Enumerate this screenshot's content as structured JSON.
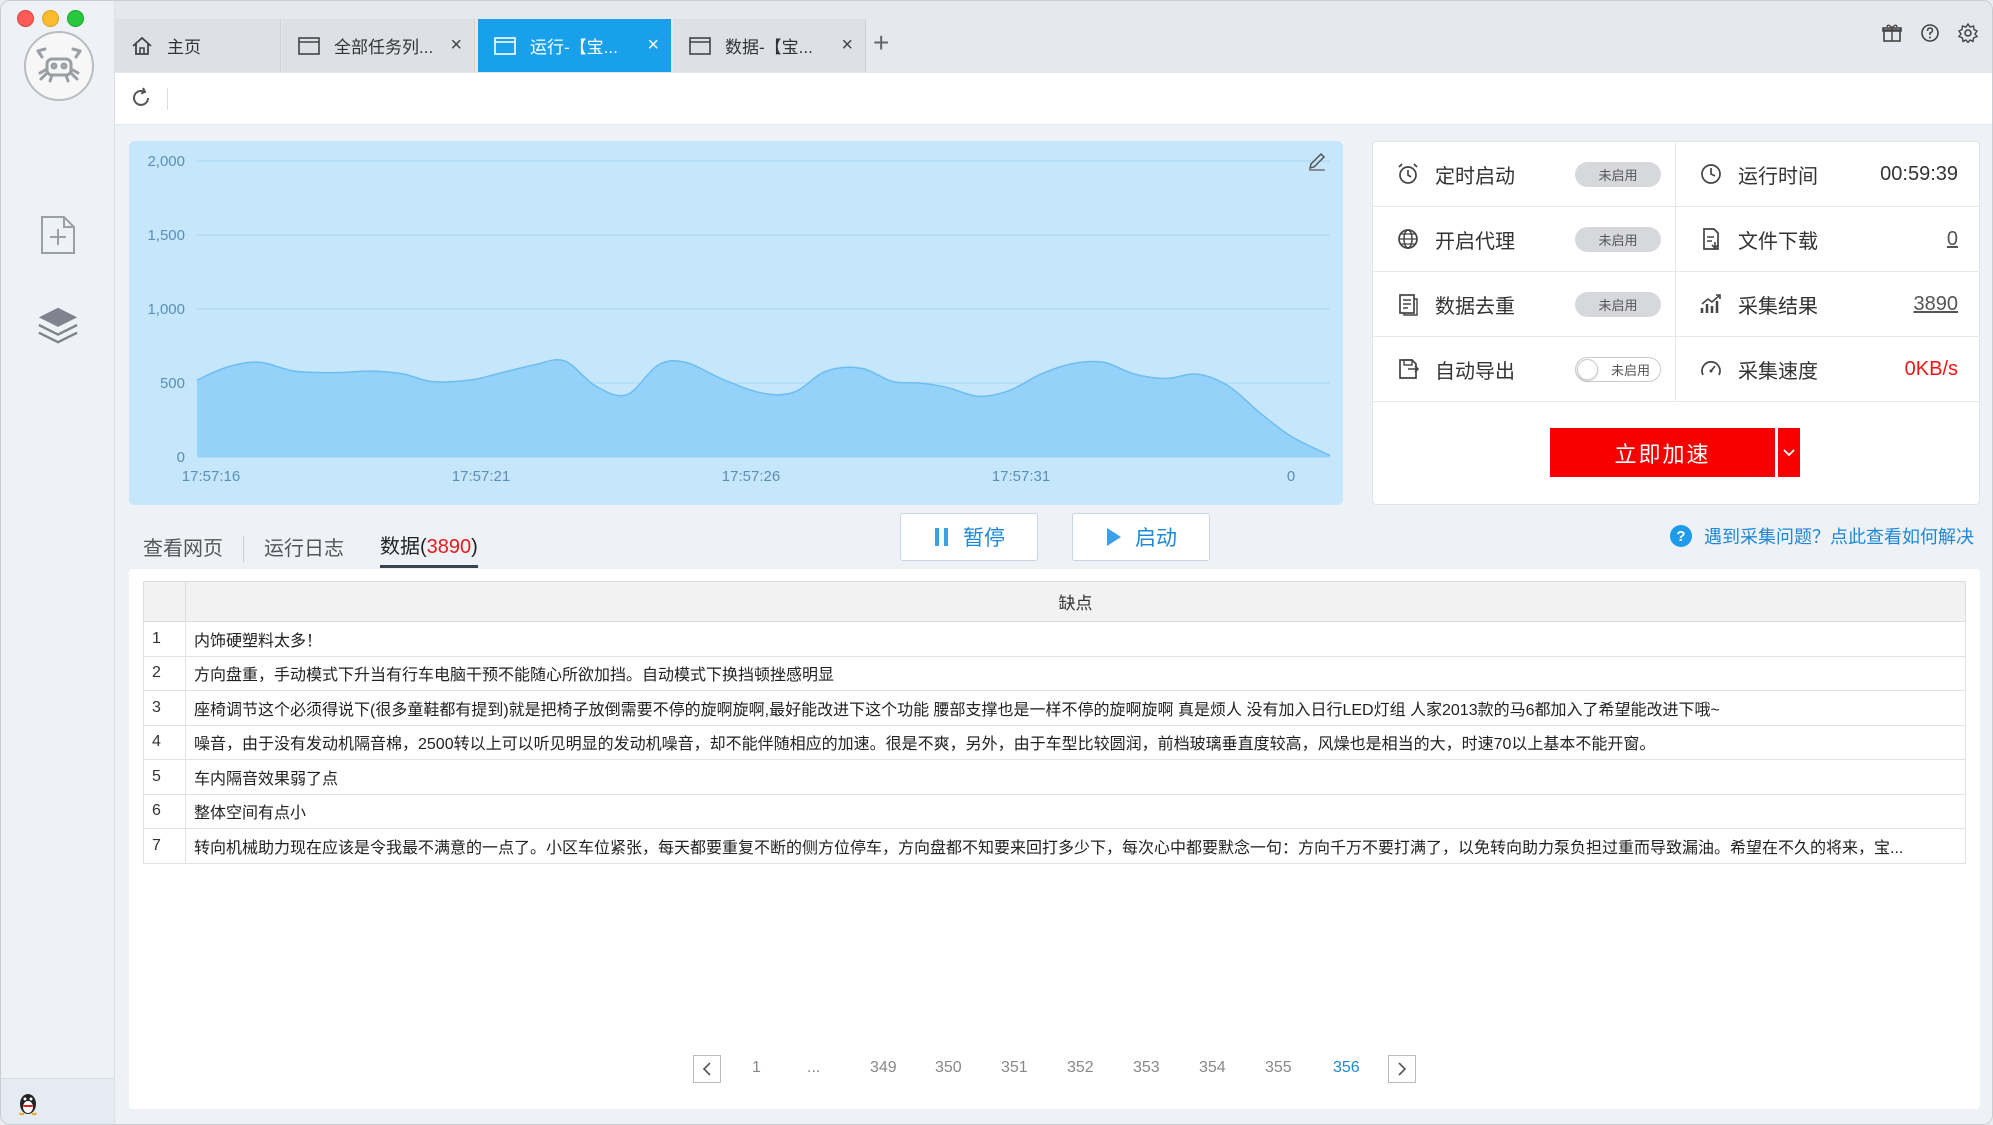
{
  "tabs": [
    {
      "label": "主页",
      "icon": "home-icon",
      "closable": false,
      "active": false
    },
    {
      "label": "全部任务列...",
      "icon": "window-icon",
      "closable": true,
      "active": false
    },
    {
      "label": "运行-【宝...",
      "icon": "window-icon",
      "closable": true,
      "active": true
    },
    {
      "label": "数据-【宝...",
      "icon": "window-icon",
      "closable": true,
      "active": false
    }
  ],
  "tab_add_label": "+",
  "toolbar_icons": [
    "gift-icon",
    "help-icon",
    "settings-icon"
  ],
  "chart_data": {
    "type": "area",
    "title": "",
    "x_tick_labels": [
      "17:57:16",
      "17:57:21",
      "17:57:26",
      "17:57:31",
      "0"
    ],
    "y_tick_labels": [
      "0",
      "500",
      "1,000",
      "1,500",
      "2,000"
    ],
    "ylim": [
      0,
      2000
    ],
    "grid": true,
    "color": "#8fcff8",
    "series": [
      {
        "x": [
          0,
          0.8,
          1.6,
          2.5,
          3.5,
          4.5,
          5.3,
          6,
          7,
          7.8,
          8.6,
          9.4,
          10.2,
          11,
          11.8,
          12.5,
          13.5,
          14.5,
          15.3,
          16.1,
          17,
          17.8,
          18.5,
          19.2,
          20,
          20.8,
          21.6,
          22.4,
          23.2,
          24,
          24.8,
          25.6,
          26.4,
          27.2,
          28,
          29
        ],
        "values": [
          520,
          610,
          640,
          580,
          570,
          580,
          560,
          510,
          520,
          570,
          620,
          650,
          480,
          420,
          620,
          640,
          520,
          430,
          440,
          580,
          600,
          510,
          500,
          470,
          410,
          450,
          560,
          630,
          640,
          560,
          530,
          560,
          480,
          300,
          140,
          10
        ]
      }
    ]
  },
  "status": {
    "schedule": {
      "label": "定时启动",
      "toggle": "未启用"
    },
    "proxy": {
      "label": "开启代理",
      "toggle": "未启用"
    },
    "dedupe": {
      "label": "数据去重",
      "toggle": "未启用"
    },
    "auto_export": {
      "label": "自动导出",
      "toggle": "未启用"
    },
    "run_time": {
      "label": "运行时间",
      "value": "00:59:39"
    },
    "file_download": {
      "label": "文件下载",
      "value": "0"
    },
    "results": {
      "label": "采集结果",
      "value": "3890"
    },
    "speed": {
      "label": "采集速度",
      "value": "0KB/s"
    }
  },
  "accelerate_label": "立即加速",
  "view_tabs": {
    "web": "查看网页",
    "log": "运行日志",
    "data": "数据(",
    "data_count": "3890",
    "data_close": ")"
  },
  "controls": {
    "pause": "暂停",
    "start": "启动"
  },
  "help_text": "遇到采集问题？点此查看如何解决",
  "table": {
    "header": "缺点",
    "rows": [
      {
        "idx": "1",
        "text": "内饰硬塑料太多！"
      },
      {
        "idx": "2",
        "text": "方向盘重，手动模式下升当有行车电脑干预不能随心所欲加挡。自动模式下换挡顿挫感明显"
      },
      {
        "idx": "3",
        "text": "座椅调节这个必须得说下(很多童鞋都有提到)就是把椅子放倒需要不停的旋啊旋啊,最好能改进下这个功能 腰部支撑也是一样不停的旋啊旋啊 真是烦人 没有加入日行LED灯组 人家2013款的马6都加入了希望能改进下哦~"
      },
      {
        "idx": "4",
        "text": "噪音，由于没有发动机隔音棉，2500转以上可以听见明显的发动机噪音，却不能伴随相应的加速。很是不爽，另外，由于车型比较圆润，前档玻璃垂直度较高，风燥也是相当的大，时速70以上基本不能开窗。"
      },
      {
        "idx": "5",
        "text": "车内隔音效果弱了点"
      },
      {
        "idx": "6",
        "text": "整体空间有点小"
      },
      {
        "idx": "7",
        "text": "转向机械助力现在应该是令我最不满意的一点了。小区车位紧张，每天都要重复不断的侧方位停车，方向盘都不知要来回打多少下，每次心中都要默念一句：方向千万不要打满了，以免转向助力泵负担过重而导致漏油。希望在不久的将来，宝..."
      }
    ]
  },
  "pagination": {
    "pages": [
      "1",
      "...",
      "349",
      "350",
      "351",
      "352",
      "353",
      "354",
      "355",
      "356"
    ],
    "current": "356"
  }
}
